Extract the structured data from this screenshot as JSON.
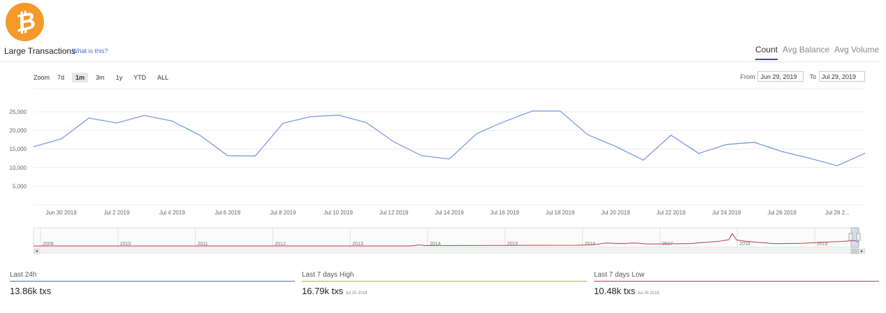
{
  "logo": {
    "glyph": "₿",
    "color": "#f39a2b",
    "icon": "bitcoin-logo-icon"
  },
  "header": {
    "title": "Large Transactions",
    "what_is": "What is this?",
    "tabs": [
      {
        "label": "Count",
        "active": true
      },
      {
        "label": "Avg Balance",
        "active": false
      },
      {
        "label": "Avg Volume",
        "active": false
      }
    ]
  },
  "toolbar": {
    "zoom_label": "Zoom",
    "zoom_options": [
      {
        "label": "7d",
        "active": false
      },
      {
        "label": "1m",
        "active": true
      },
      {
        "label": "3m",
        "active": false
      },
      {
        "label": "1y",
        "active": false
      },
      {
        "label": "YTD",
        "active": false
      },
      {
        "label": "ALL",
        "active": false
      }
    ],
    "from_label": "From",
    "from_value": "Jun 29, 2019",
    "to_label": "To",
    "to_value": "Jul 29, 2019"
  },
  "chart_data": {
    "type": "line",
    "title": "",
    "ylim": [
      5000,
      25000
    ],
    "y_ticks": [
      "5,000",
      "10,000",
      "15,000",
      "20,000",
      "25,000"
    ],
    "grid": true,
    "line_color": "#7b9be0",
    "x_tick_labels": [
      "Jun 30 2019",
      "Jul 2 2019",
      "Jul 4 2019",
      "Jul 6 2019",
      "Jul 8 2019",
      "Jul 10 2019",
      "Jul 12 2019",
      "Jul 14 2019",
      "Jul 16 2019",
      "Jul 18 2019",
      "Jul 20 2019",
      "Jul 22 2019",
      "Jul 24 2019",
      "Jul 26 2019",
      "Jul 28 2..."
    ],
    "x": [
      "Jun 29",
      "Jun 30",
      "Jul 1",
      "Jul 2",
      "Jul 3",
      "Jul 4",
      "Jul 5",
      "Jul 6",
      "Jul 7",
      "Jul 8",
      "Jul 9",
      "Jul 10",
      "Jul 11",
      "Jul 12",
      "Jul 13",
      "Jul 14",
      "Jul 15",
      "Jul 16",
      "Jul 17",
      "Jul 18",
      "Jul 19",
      "Jul 20",
      "Jul 21",
      "Jul 22",
      "Jul 23",
      "Jul 24",
      "Jul 25",
      "Jul 26",
      "Jul 27",
      "Jul 28",
      "Jul 29"
    ],
    "values": [
      15600,
      17700,
      23300,
      22000,
      24000,
      22500,
      18700,
      13200,
      13100,
      21900,
      23700,
      24100,
      22100,
      16900,
      13200,
      12300,
      19200,
      22400,
      25200,
      25200,
      18800,
      15700,
      12000,
      18700,
      13800,
      16200,
      16790,
      14300,
      12500,
      10480,
      13860
    ]
  },
  "navigator": {
    "years": [
      "2009",
      "2010",
      "2011",
      "2012",
      "2013",
      "2014",
      "2015",
      "2016",
      "2017",
      "2018",
      "2019"
    ],
    "line_color": "#c0384f"
  },
  "stats": [
    {
      "label": "Last 24h",
      "value": "13.86k txs",
      "date": "",
      "color": "#4a6fd6"
    },
    {
      "label": "Last 7 days High",
      "value": "16.79k txs",
      "date": "Jul 25 2019",
      "color": "#8cc152"
    },
    {
      "label": "Last 7 days Low",
      "value": "10.48k txs",
      "date": "Jul 28 2019",
      "color": "#c0384f"
    }
  ]
}
